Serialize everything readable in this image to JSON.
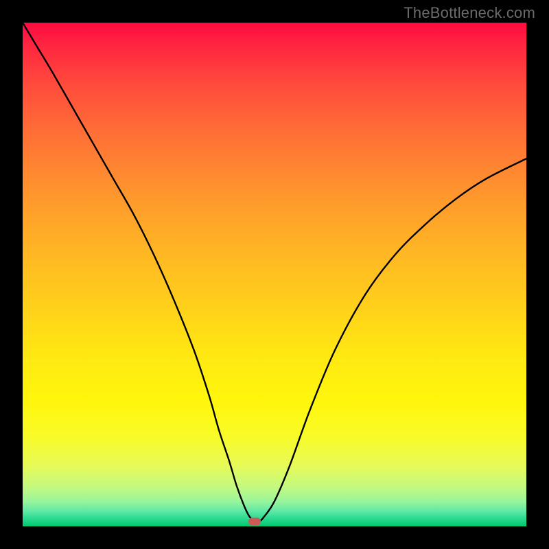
{
  "watermark": "TheBottleneck.com",
  "chart_data": {
    "type": "line",
    "title": "",
    "xlabel": "",
    "ylabel": "",
    "xlim": [
      0,
      100
    ],
    "ylim": [
      0,
      100
    ],
    "grid": false,
    "legend": false,
    "series": [
      {
        "name": "bottleneck-curve",
        "x": [
          0,
          3,
          6,
          10,
          14,
          18,
          22,
          26,
          30,
          34,
          37,
          39,
          41,
          42.5,
          44,
          45,
          46,
          47,
          48,
          50,
          53,
          57,
          62,
          68,
          74,
          80,
          86,
          92,
          100
        ],
        "y": [
          100,
          95,
          90,
          83,
          76,
          69,
          62,
          54,
          45,
          35,
          26,
          19,
          13,
          8,
          4,
          2,
          1,
          1,
          2,
          5,
          12,
          23,
          35,
          46,
          54,
          60,
          65,
          69,
          73
        ]
      }
    ],
    "marker": {
      "x": 46,
      "y": 1,
      "color": "#cc5a55"
    },
    "background_gradient": {
      "top": "#ff0a3f",
      "mid": "#ffd21a",
      "bottom": "#00c76f"
    }
  }
}
